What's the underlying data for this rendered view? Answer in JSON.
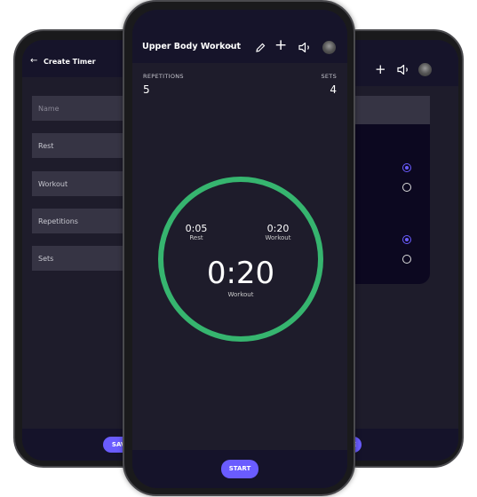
{
  "create_timer": {
    "title": "Create Timer",
    "fields": [
      {
        "placeholder": "Name"
      },
      {
        "label": "Rest"
      },
      {
        "label": "Workout"
      },
      {
        "label": "Repetitions"
      },
      {
        "label": "Sets"
      }
    ],
    "save_label": "SAVE"
  },
  "settings": {
    "save_label": "SAVE",
    "radios": [
      true,
      false,
      true,
      false
    ]
  },
  "timer": {
    "title": "Upper Body Workout",
    "repetitions_label": "REPETITIONS",
    "repetitions": "5",
    "sets_label": "SETS",
    "sets": "4",
    "rest_time": "0:05",
    "rest_label": "Rest",
    "workout_time": "0:20",
    "workout_label": "Workout",
    "current_time": "0:20",
    "current_label": "Workout",
    "start_label": "START",
    "ring_color": "#36b56f",
    "progress": 1.0
  },
  "colors": {
    "accent": "#6a5cff",
    "background": "#1e1c2b",
    "header": "#16142a"
  }
}
